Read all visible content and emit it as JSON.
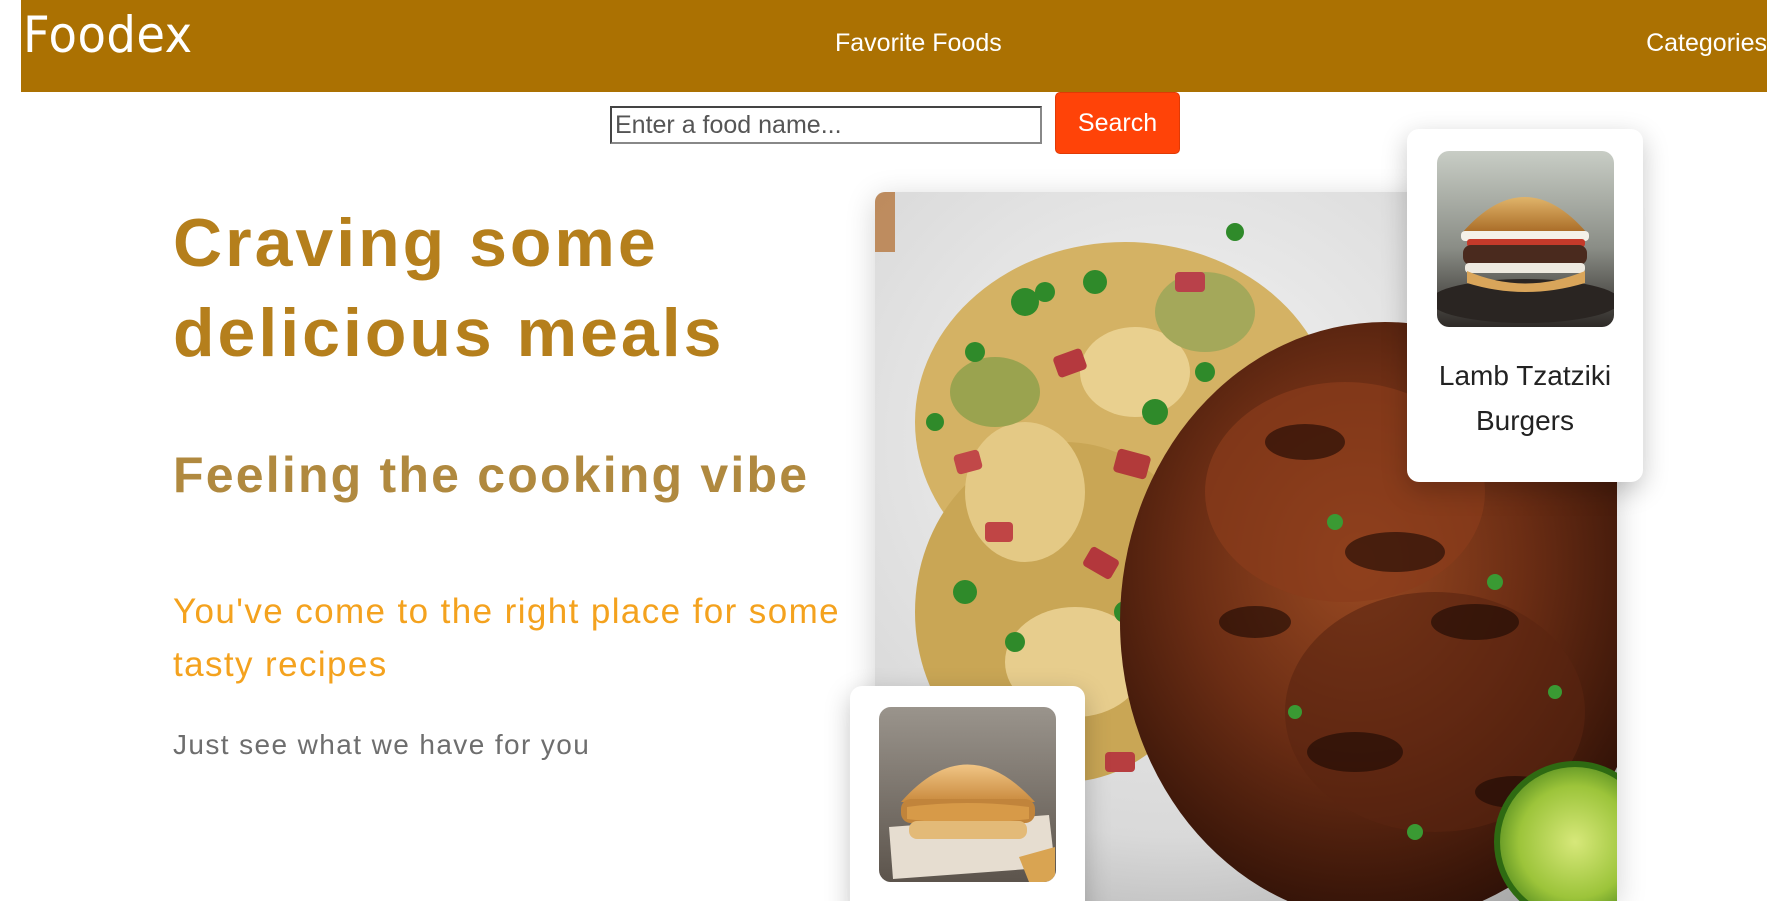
{
  "nav": {
    "brand": "Foodex",
    "links": [
      {
        "label": "Favorite Foods"
      },
      {
        "label": "Categories"
      }
    ]
  },
  "search": {
    "placeholder": "Enter a food name...",
    "value": "",
    "button_label": "Search"
  },
  "hero": {
    "title": "Craving some delicious meals",
    "subtitle": "Feeling the cooking vibe",
    "tagline": "You've come to the right place for some tasty recipes",
    "note": "Just see what we have for you"
  },
  "cards": [
    {
      "name": "Lamb Tzatziki Burgers",
      "image": "burger-photo"
    },
    {
      "name": "",
      "image": "chicken-sandwich-photo"
    }
  ],
  "hero_image": "roast-chicken-salad-photo",
  "colors": {
    "nav_bg": "#ab7102",
    "search_button": "#ff4308",
    "title": "#b57f1c",
    "subtitle": "#b0893f",
    "tagline": "#f4a21e",
    "note": "#6e6e6e"
  }
}
